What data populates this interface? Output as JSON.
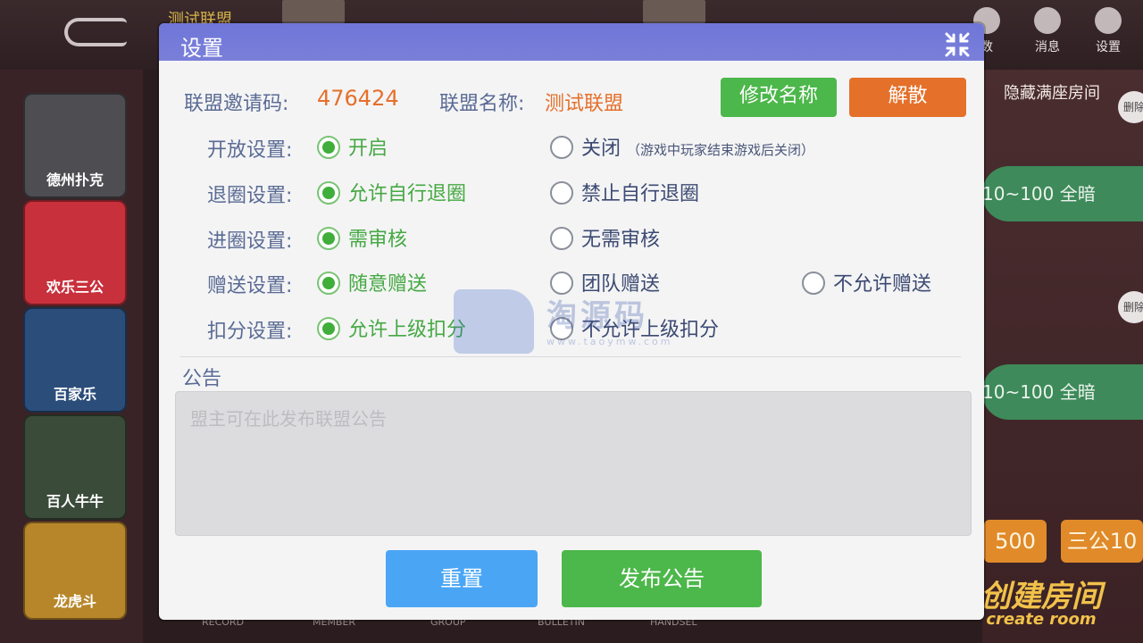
{
  "background": {
    "top_tag": "测试联盟",
    "top_icons": [
      {
        "label": "数",
        "icon": "clipboard-icon"
      },
      {
        "label": "消息",
        "icon": "bell-icon"
      },
      {
        "label": "设置",
        "icon": "gear-icon"
      }
    ],
    "games": [
      "德州扑克",
      "欢乐三公",
      "百家乐",
      "百人牛牛",
      "龙虎斗"
    ],
    "hide_full_rooms": "隐藏满座房间",
    "table_label_1": "10~100 全暗",
    "table_label_2": "10~100 全暗",
    "delete_label": "删除",
    "orange_btn_1": "500",
    "orange_btn_2": "三公10",
    "create_room_cn": "创建房间",
    "create_room_en": "create room",
    "bottom_nav": [
      "RECORD",
      "MEMBER",
      "GROUP",
      "BULLETIN",
      "HANDSEL"
    ]
  },
  "dialog": {
    "title": "设置",
    "collapse_icon": "collapse-arrows-icon",
    "invite_code_label": "联盟邀请码:",
    "invite_code": "476424",
    "alliance_name_label": "联盟名称:",
    "alliance_name": "测试联盟",
    "rename_button": "修改名称",
    "dissolve_button": "解散",
    "settings": [
      {
        "label": "开放设置:",
        "options": [
          "开启",
          "关闭"
        ],
        "note": "（游戏中玩家结束游戏后关闭）",
        "selected": 0
      },
      {
        "label": "退圈设置:",
        "options": [
          "允许自行退圈",
          "禁止自行退圈"
        ],
        "selected": 0
      },
      {
        "label": "进圈设置:",
        "options": [
          "需审核",
          "无需审核"
        ],
        "selected": 0
      },
      {
        "label": "赠送设置:",
        "options": [
          "随意赠送",
          "团队赠送",
          "不允许赠送"
        ],
        "selected": 0
      },
      {
        "label": "扣分设置:",
        "options": [
          "允许上级扣分",
          "不允许上级扣分"
        ],
        "selected": 0
      }
    ],
    "notice_label": "公告",
    "notice_placeholder": "盟主可在此发布联盟公告",
    "reset_button": "重置",
    "publish_button": "发布公告",
    "colors": {
      "header": "#7278d8",
      "green": "#4cb74a",
      "orange": "#e5702a",
      "blue": "#4aa6f5"
    }
  },
  "watermark": {
    "text": "淘源码",
    "sub": "www.taoymw.com"
  }
}
